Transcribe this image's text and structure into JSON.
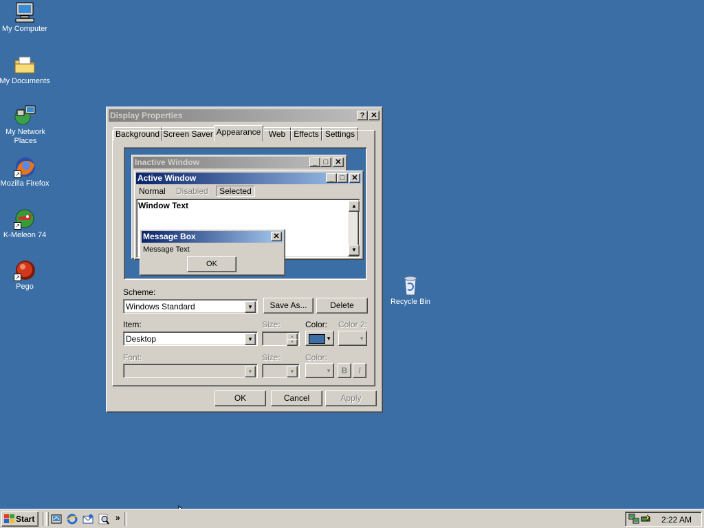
{
  "desktop": {
    "icons": [
      {
        "label": "My Computer"
      },
      {
        "label": "My Documents"
      },
      {
        "label": "My Network Places"
      },
      {
        "label": "Mozilla Firefox"
      },
      {
        "label": "K-Meleon 74"
      },
      {
        "label": "Pego"
      },
      {
        "label": "Recycle Bin"
      }
    ]
  },
  "dialog": {
    "title": "Display Properties",
    "help_btn": "?",
    "close_btn": "✕",
    "tabs": [
      "Background",
      "Screen Saver",
      "Appearance",
      "Web",
      "Effects",
      "Settings"
    ],
    "active_tab": "Appearance",
    "preview": {
      "inactive_title": "Inactive Window",
      "active_title": "Active Window",
      "menu": [
        "Normal",
        "Disabled",
        "Selected"
      ],
      "window_text": "Window Text",
      "msgbox_title": "Message Box",
      "msgbox_text": "Message Text",
      "msgbox_ok": "OK"
    },
    "scheme_label": "Scheme:",
    "scheme_value": "Windows Standard",
    "save_as": "Save As...",
    "delete": "Delete",
    "item_label": "Item:",
    "item_value": "Desktop",
    "size_label": "Size:",
    "color_label": "Color:",
    "color2_label": "Color 2:",
    "font_label": "Font:",
    "font_size_label": "Size:",
    "font_color_label": "Color:",
    "bold": "B",
    "italic": "I",
    "selected_color": "#3a6ea5",
    "ok": "OK",
    "cancel": "Cancel",
    "apply": "Apply"
  },
  "taskbar": {
    "start": "Start",
    "chevron": "»",
    "clock": "2:22 AM"
  }
}
